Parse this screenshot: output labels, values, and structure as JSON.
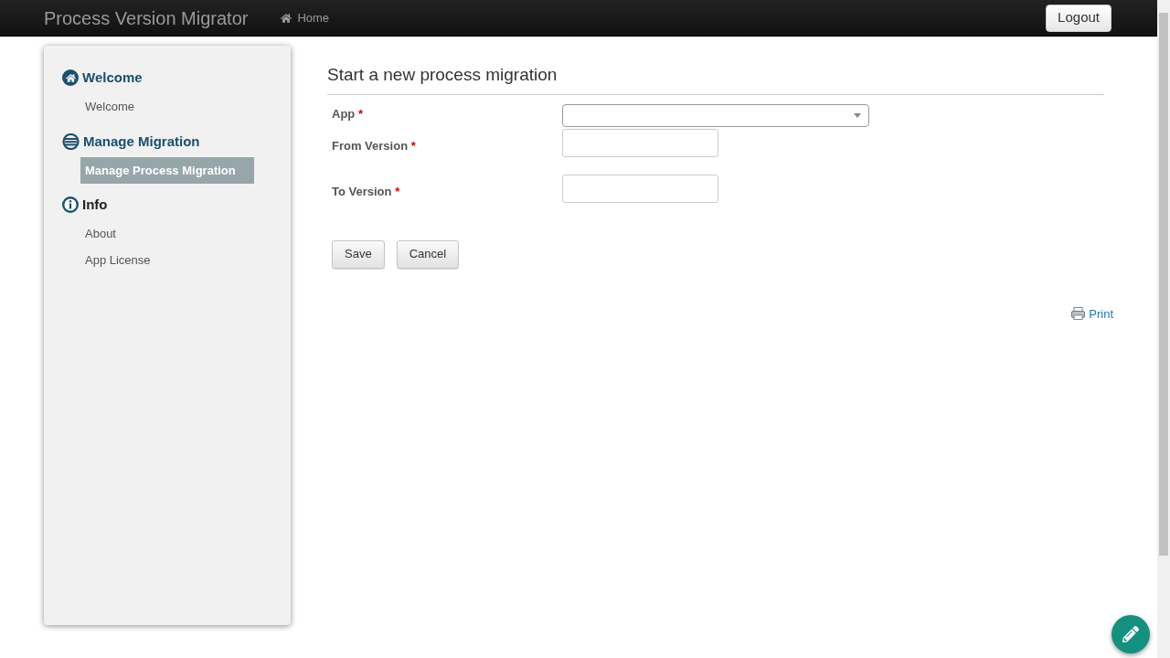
{
  "navbar": {
    "brand": "Process Version Migrator",
    "home_link": "Home",
    "logout": "Logout"
  },
  "sidebar": {
    "sections": [
      {
        "title": "Welcome",
        "items": [
          {
            "label": "Welcome",
            "selected": false
          }
        ]
      },
      {
        "title": "Manage Migration",
        "items": [
          {
            "label": "Manage Process Migration",
            "selected": true
          }
        ]
      },
      {
        "title": "Info",
        "items": [
          {
            "label": "About",
            "selected": false
          },
          {
            "label": "App License",
            "selected": false
          }
        ]
      }
    ]
  },
  "form": {
    "title": "Start a new process migration",
    "fields": [
      {
        "label": "App",
        "required_mark": "*",
        "kind": "select"
      },
      {
        "label": "From Version",
        "required_mark": "*",
        "kind": "text"
      },
      {
        "label": "To Version",
        "required_mark": "*",
        "kind": "text"
      }
    ],
    "buttons": [
      "Save",
      "Cancel"
    ]
  },
  "print_link": "Print"
}
